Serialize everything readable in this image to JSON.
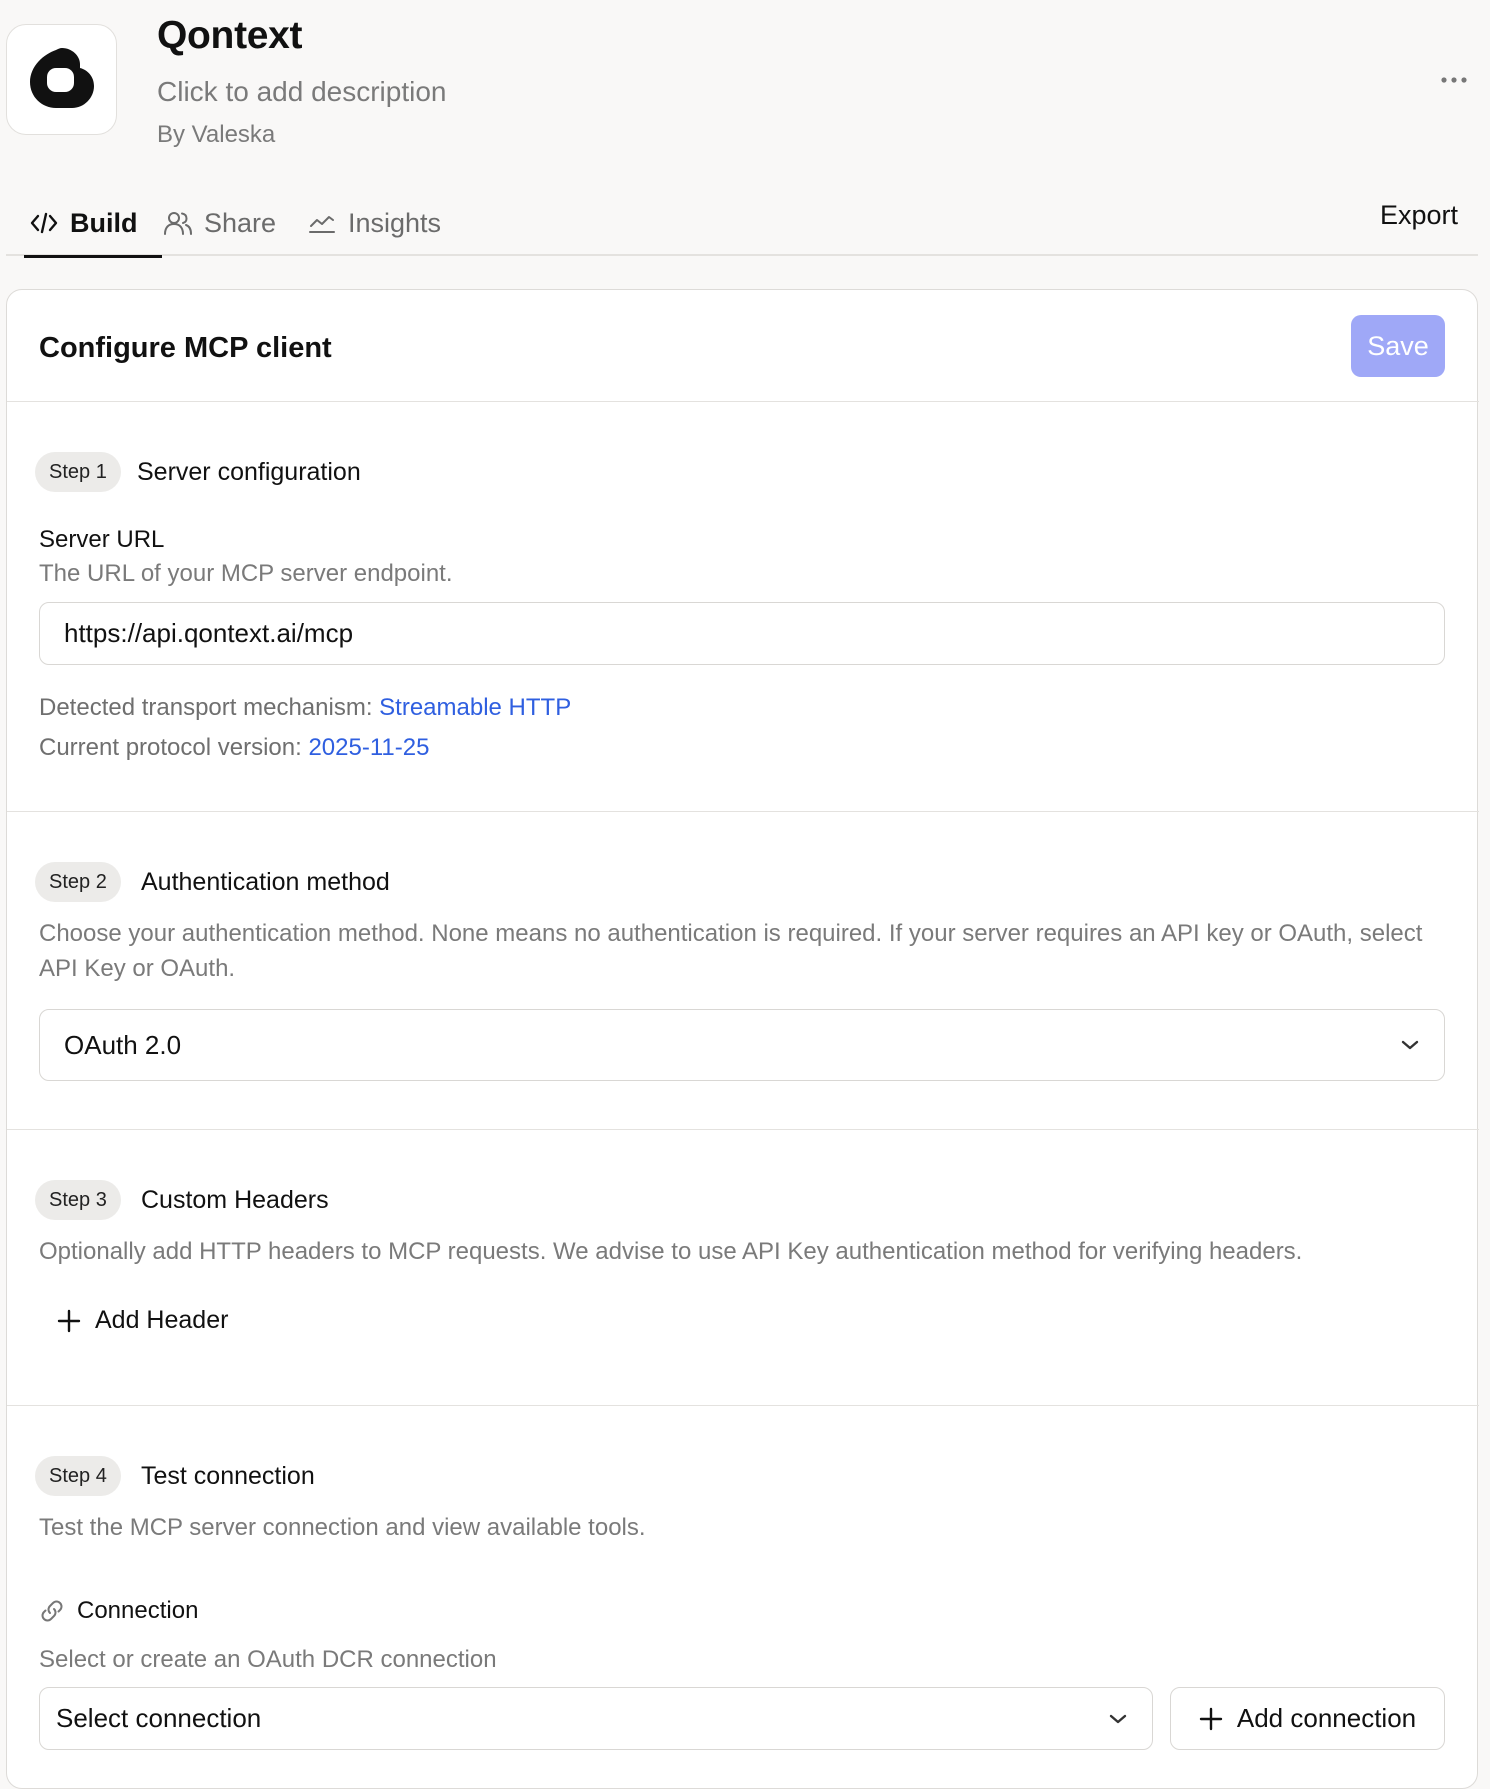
{
  "app": {
    "title": "Qontext",
    "description_placeholder": "Click to add description",
    "author": "By Valeska"
  },
  "tabs": [
    {
      "label": "Build",
      "icon": "code-icon",
      "active": true
    },
    {
      "label": "Share",
      "icon": "users-icon",
      "active": false
    },
    {
      "label": "Insights",
      "icon": "chart-line-icon",
      "active": false
    }
  ],
  "export_label": "Export",
  "panel": {
    "title": "Configure MCP client",
    "save_label": "Save",
    "save_color": "#9fa8f7"
  },
  "step1": {
    "badge": "Step 1",
    "title": "Server configuration",
    "field_label": "Server URL",
    "help": "The URL of your MCP server endpoint.",
    "url_value": "https://api.qontext.ai/mcp",
    "transport_label": "Detected transport mechanism:",
    "transport_value": "Streamable HTTP",
    "protocol_label": "Current protocol version:",
    "protocol_value": "2025-11-25",
    "link_color": "#2f5fe0"
  },
  "step2": {
    "badge": "Step 2",
    "title": "Authentication method",
    "help": "Choose your authentication method. None means no authentication is required. If your server requires an API key or OAuth, select API Key or OAuth.",
    "selected": "OAuth 2.0"
  },
  "step3": {
    "badge": "Step 3",
    "title": "Custom Headers",
    "help": "Optionally add HTTP headers to MCP requests. We advise to use API Key authentication method for verifying headers.",
    "add_label": "Add Header"
  },
  "step4": {
    "badge": "Step 4",
    "title": "Test connection",
    "help": "Test the MCP server connection and view available tools.",
    "connection_label": "Connection",
    "connection_help": "Select or create an OAuth DCR connection",
    "select_placeholder": "Select connection",
    "add_connection_label": "Add connection"
  }
}
